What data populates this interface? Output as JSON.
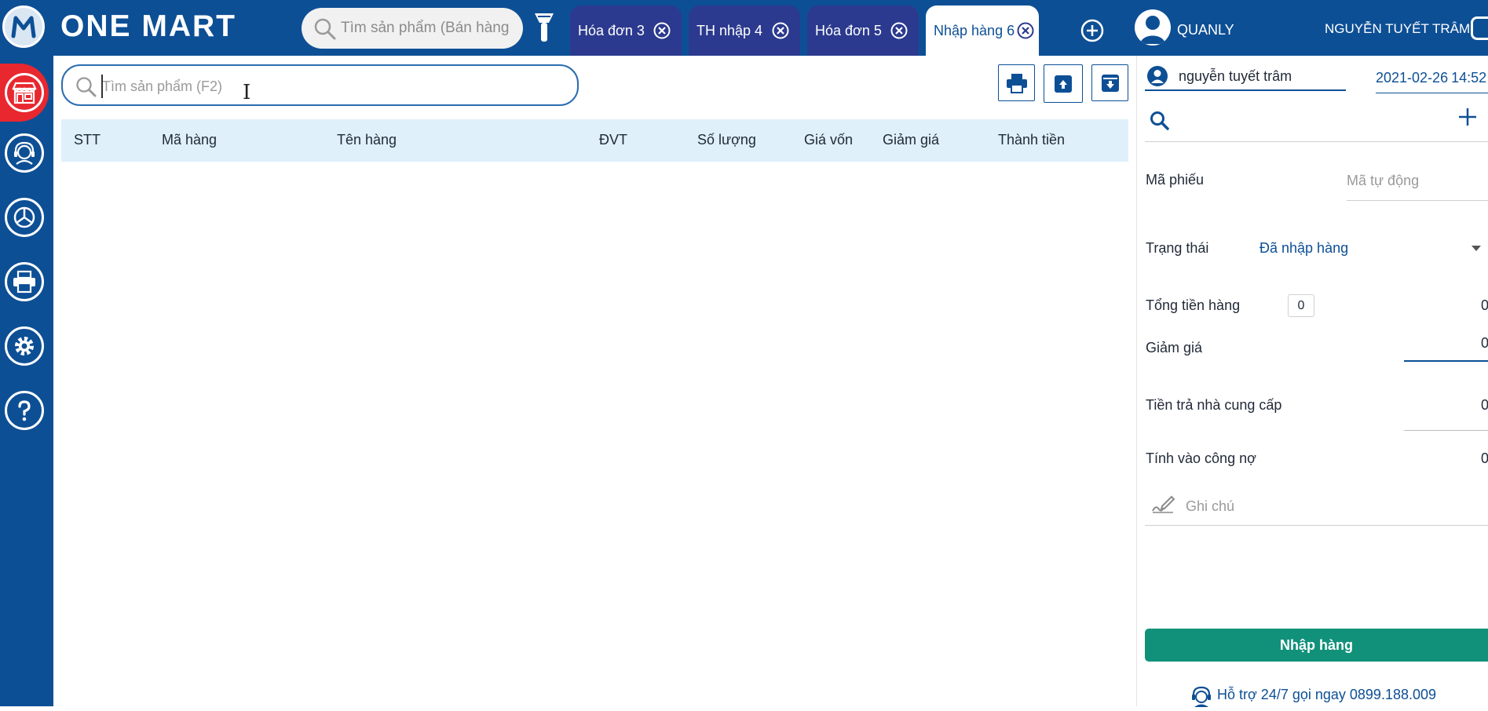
{
  "app": {
    "brand": "ONE MART"
  },
  "header": {
    "search_placeholder": "Tìm sản phẩm (Bán hàng",
    "tabs": [
      {
        "label": "Hóa đơn 3"
      },
      {
        "label": "TH nhập 4"
      },
      {
        "label": "Hóa đơn 5"
      },
      {
        "label": "Nhập hàng 6",
        "active": true
      }
    ],
    "user_role": "QUANLY",
    "user_name": "NGUYỄN TUYẾT TRÂM"
  },
  "sidebar": {
    "items": [
      "store-icon",
      "support-agent-icon",
      "report-chart-icon",
      "printer-icon",
      "settings-gear-icon",
      "help-icon"
    ]
  },
  "main": {
    "search_placeholder": "Tìm sản phẩm (F2)",
    "columns": [
      "STT",
      "Mã hàng",
      "Tên hàng",
      "ĐVT",
      "Số lượng",
      "Giá vốn",
      "Giảm giá",
      "Thành tiền"
    ],
    "rows": []
  },
  "panel": {
    "user": "nguyễn tuyết trâm",
    "date": "2021-02-26",
    "time": "14:52",
    "ma_phieu_label": "Mã phiếu",
    "ma_phieu_placeholder": "Mã tự động",
    "trang_thai_label": "Trạng thái",
    "trang_thai_value": "Đã nhập hàng",
    "tong_tien_label": "Tổng tiền hàng",
    "tong_tien_count": "0",
    "tong_tien_value": "0",
    "giam_gia_label": "Giảm giá",
    "giam_gia_value": "0",
    "tien_tra_label": "Tiền trả nhà cung cấp",
    "tien_tra_value": "0",
    "cong_no_label": "Tính vào công nợ",
    "cong_no_value": "0",
    "note_placeholder": "Ghi chú",
    "submit_label": "Nhập hàng",
    "support_text": "Hỗ trợ 24/7 gọi ngay 0899.188.009"
  },
  "colors": {
    "primary": "#0d4f95",
    "tab": "#2b3a8e",
    "accent_red": "#e8272f",
    "submit": "#12917a",
    "table_header": "#dff0fb"
  }
}
